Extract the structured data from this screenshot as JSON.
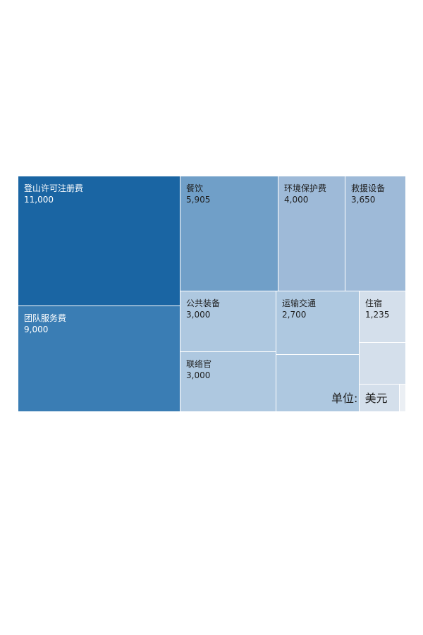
{
  "chart_data": {
    "type": "treemap",
    "unit_label": "单位:  美元",
    "items": [
      {
        "name": "登山许可注册费",
        "value": "11,000",
        "color": "#1a65a3",
        "dark": true
      },
      {
        "name": "团队服务费",
        "value": "9,000",
        "color": "#3a7db4",
        "dark": true
      },
      {
        "name": "餐饮",
        "value": "5,905",
        "color": "#709fc8",
        "dark": false
      },
      {
        "name": "环境保护费",
        "value": "4,000",
        "color": "#9ebad8",
        "dark": false
      },
      {
        "name": "救援设备",
        "value": "3,650",
        "color": "#9ebad8",
        "dark": false
      },
      {
        "name": "公共装备",
        "value": "3,000",
        "color": "#aec8e0",
        "dark": false
      },
      {
        "name": "运输交通",
        "value": "2,700",
        "color": "#aec8e0",
        "dark": false
      },
      {
        "name": "住宿",
        "value": "1,235",
        "color": "#d4dfeb",
        "dark": false
      },
      {
        "name": "联络官",
        "value": "3,000",
        "color": "#aec8e0",
        "dark": false
      },
      {
        "name": "",
        "value": "",
        "color": "#aec8e0",
        "dark": false
      },
      {
        "name": "",
        "value": "",
        "color": "#d4dfeb",
        "dark": false
      },
      {
        "name": "",
        "value": "",
        "color": "#d4dfeb",
        "dark": false
      },
      {
        "name": "",
        "value": "",
        "color": "#ebeff4",
        "dark": false
      }
    ]
  }
}
